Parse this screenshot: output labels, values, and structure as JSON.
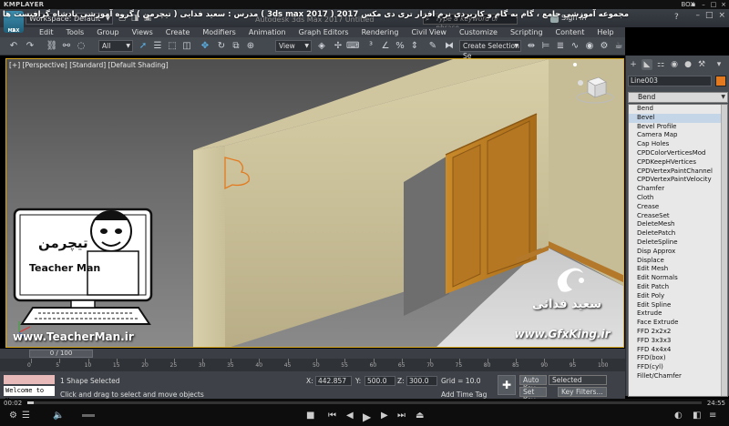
{
  "player": {
    "brand": "KMPLAYER",
    "box": "BOX",
    "time_elapsed": "00:02",
    "time_total": "24:55",
    "progress": 0.01
  },
  "app": {
    "logo": "3",
    "logo_sub": "MAX",
    "workspace": "Workspace: Default",
    "title": "Autodesk 3ds Max 2017    Untitled",
    "search_placeholder": "Type a keyword or phrase",
    "sign_in": "Sign In",
    "help": "?"
  },
  "overlay": {
    "persian_title": "مجموعه آموزشی جامع ، گام به گام و کاربردی نرم افزار تری دی مکس 2017  ( 3ds max 2017 )   مدرس : سعید فدایی ( تیچرمن ) گروه آموزشی پادشاه گرافیست ها",
    "teacher_url": "www.TeacherMan.ir",
    "teacher_brand": "Teacher Man",
    "teacher_persian": "تیچرمن",
    "gfx_name": "سعید فدائی",
    "gfx_url": "www.GfxKing.ir"
  },
  "menu": [
    "Edit",
    "Tools",
    "Group",
    "Views",
    "Create",
    "Modifiers",
    "Animation",
    "Graph Editors",
    "Rendering",
    "Civil View",
    "Customize",
    "Scripting",
    "Content",
    "Help"
  ],
  "toolbar": {
    "filter": "All",
    "ref_coord": "View",
    "selection_set": "Create Selection Se"
  },
  "viewport": {
    "label": "[+] [Perspective] [Standard] [Default Shading]"
  },
  "command_panel": {
    "object_name": "Line003",
    "object_color": "#e47a1f",
    "modifier_dropdown": "Bend",
    "modifiers": [
      "Bend",
      "Bevel",
      "Bevel Profile",
      "Camera Map",
      "Cap Holes",
      "CPDColorVerticesMod",
      "CPDKeepHVertices",
      "CPDVertexPaintChannel",
      "CPDVertexPaintVelocity",
      "Chamfer",
      "Cloth",
      "Crease",
      "CreaseSet",
      "DeleteMesh",
      "DeletePatch",
      "DeleteSpline",
      "Disp Approx",
      "Displace",
      "Edit Mesh",
      "Edit Normals",
      "Edit Patch",
      "Edit Poly",
      "Edit Spline",
      "Extrude",
      "Face Extrude",
      "FFD 2x2x2",
      "FFD 3x3x3",
      "FFD 4x4x4",
      "FFD(box)",
      "FFD(cyl)",
      "Fillet/Chamfer"
    ],
    "highlighted_index": 1
  },
  "timeline": {
    "frame_counter": "0 / 100",
    "ticks": [
      "0",
      "5",
      "10",
      "15",
      "20",
      "25",
      "30",
      "35",
      "40",
      "45",
      "50",
      "55",
      "60",
      "65",
      "70",
      "75",
      "80",
      "85",
      "90",
      "95",
      "100"
    ]
  },
  "status": {
    "listener": "Welcome to M.",
    "selected": "1 Shape Selected",
    "prompt": "Click and drag to select and move objects",
    "x_label": "X:",
    "x_value": "442.857",
    "y_label": "Y:",
    "y_value": "500.0",
    "z_label": "Z:",
    "z_value": "300.0",
    "grid": "Grid = 10.0",
    "add_time_tag": "Add Time Tag",
    "auto_key": "Auto Key",
    "set_key": "Set Key",
    "selected_dd": "Selected",
    "key_filters": "Key Filters..."
  }
}
